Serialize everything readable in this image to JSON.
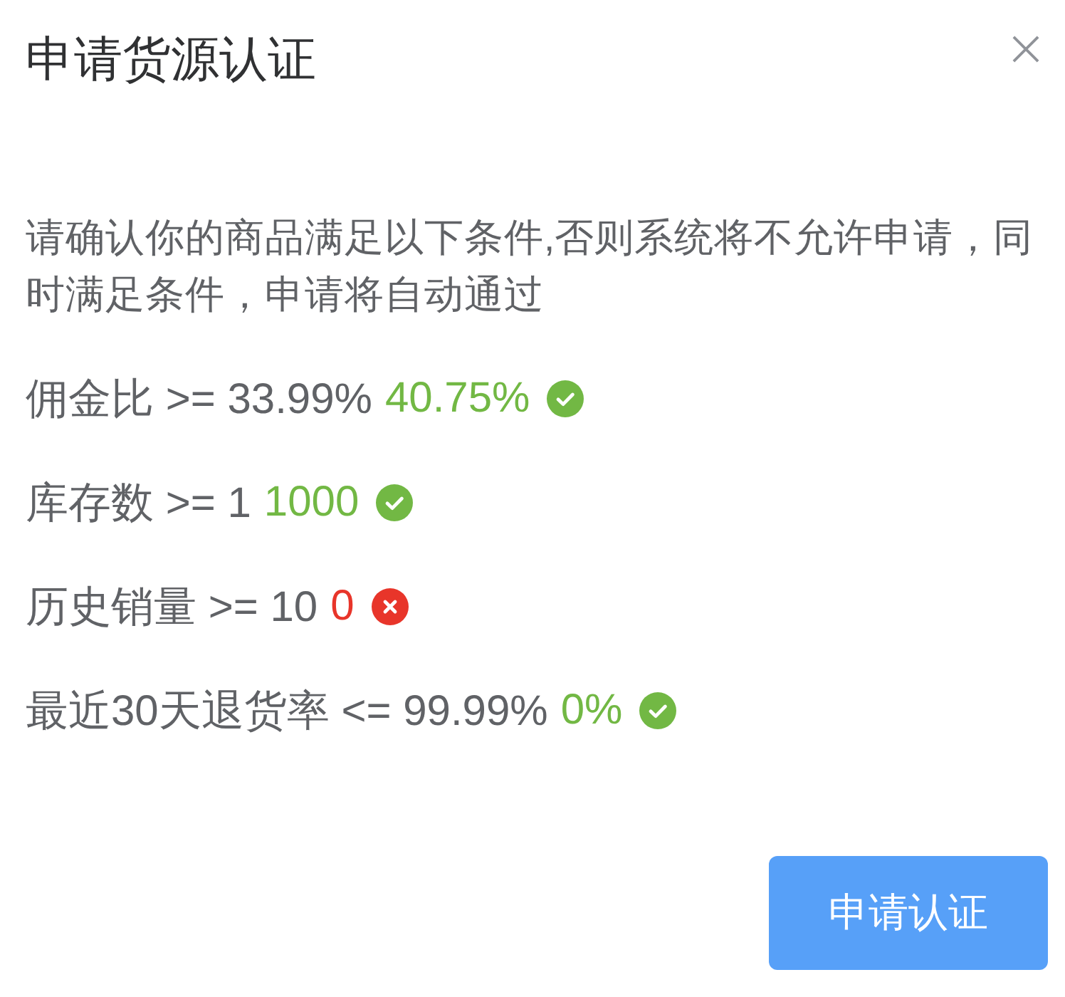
{
  "dialog": {
    "title": "申请货源认证",
    "description": "请确认你的商品满足以下条件,否则系统将不允许申请，同时满足条件，申请将自动通过",
    "conditions": [
      {
        "label": "佣金比 >= 33.99%",
        "value": "40.75%",
        "passed": true
      },
      {
        "label": "库存数 >= 1",
        "value": "1000",
        "passed": true
      },
      {
        "label": "历史销量 >= 10",
        "value": "0",
        "passed": false
      },
      {
        "label": "最近30天退货率 <= 99.99%",
        "value": "0%",
        "passed": true
      }
    ],
    "button": "申请认证"
  }
}
